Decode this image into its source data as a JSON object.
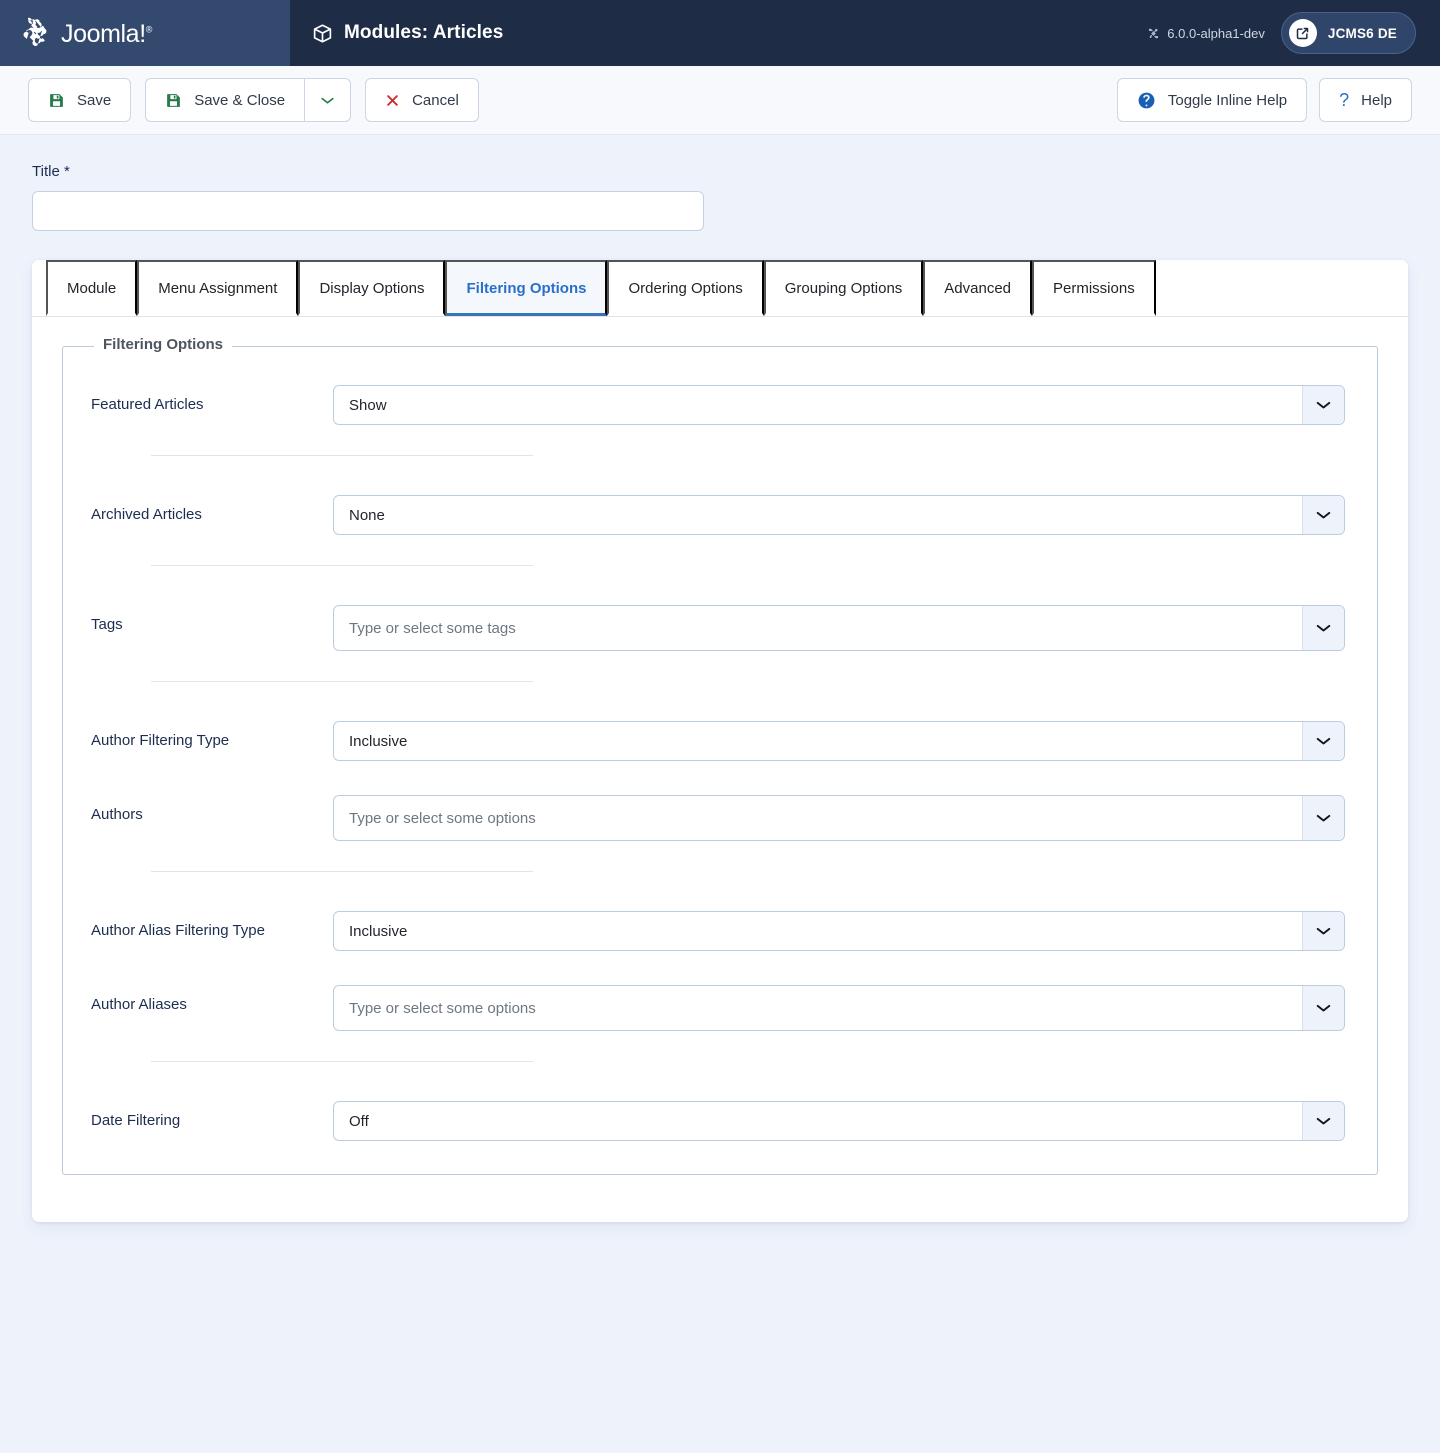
{
  "header": {
    "brand_name": "Joomla!",
    "brand_mark": "joomla-logo",
    "page_icon": "cube-icon",
    "title": "Modules: Articles",
    "version": "6.0.0-alpha1-dev",
    "version_icon": "joomla-mark-icon",
    "site_button_label": "JCMS6 DE",
    "site_button_icon": "external-link-icon"
  },
  "toolbar": {
    "save_label": "Save",
    "save_icon": "floppy-disk-icon",
    "save_close_label": "Save & Close",
    "save_close_icon": "floppy-disk-icon",
    "dropdown_icon": "chevron-down-icon",
    "cancel_label": "Cancel",
    "cancel_icon": "close-x-icon",
    "toggle_inline_help_label": "Toggle Inline Help",
    "toggle_inline_help_icon": "help-circle-icon",
    "help_label": "Help",
    "help_icon": "question-mark-icon"
  },
  "form": {
    "title_label": "Title *",
    "title_value": "",
    "title_placeholder": ""
  },
  "tabs": [
    {
      "label": "Module",
      "active": false
    },
    {
      "label": "Menu Assignment",
      "active": false
    },
    {
      "label": "Display Options",
      "active": false
    },
    {
      "label": "Filtering Options",
      "active": true
    },
    {
      "label": "Ordering Options",
      "active": false
    },
    {
      "label": "Grouping Options",
      "active": false
    },
    {
      "label": "Advanced",
      "active": false
    },
    {
      "label": "Permissions",
      "active": false
    }
  ],
  "fieldset": {
    "legend": "Filtering Options",
    "fields": {
      "featured_articles": {
        "label": "Featured Articles",
        "value": "Show"
      },
      "archived_articles": {
        "label": "Archived Articles",
        "value": "None"
      },
      "tags": {
        "label": "Tags",
        "placeholder": "Type or select some tags"
      },
      "author_filtering_type": {
        "label": "Author Filtering Type",
        "value": "Inclusive"
      },
      "authors": {
        "label": "Authors",
        "placeholder": "Type or select some options"
      },
      "author_alias_filtering_type": {
        "label": "Author Alias Filtering Type",
        "value": "Inclusive"
      },
      "author_aliases": {
        "label": "Author Aliases",
        "placeholder": "Type or select some options"
      },
      "date_filtering": {
        "label": "Date Filtering",
        "value": "Off"
      }
    }
  },
  "colors": {
    "brand_navy": "#33496e",
    "header_navy": "#1e2c45",
    "page_bg": "#eef2fb",
    "accent_blue": "#2a6fc9",
    "save_green": "#287a4c",
    "cancel_red": "#cc2a2a"
  }
}
